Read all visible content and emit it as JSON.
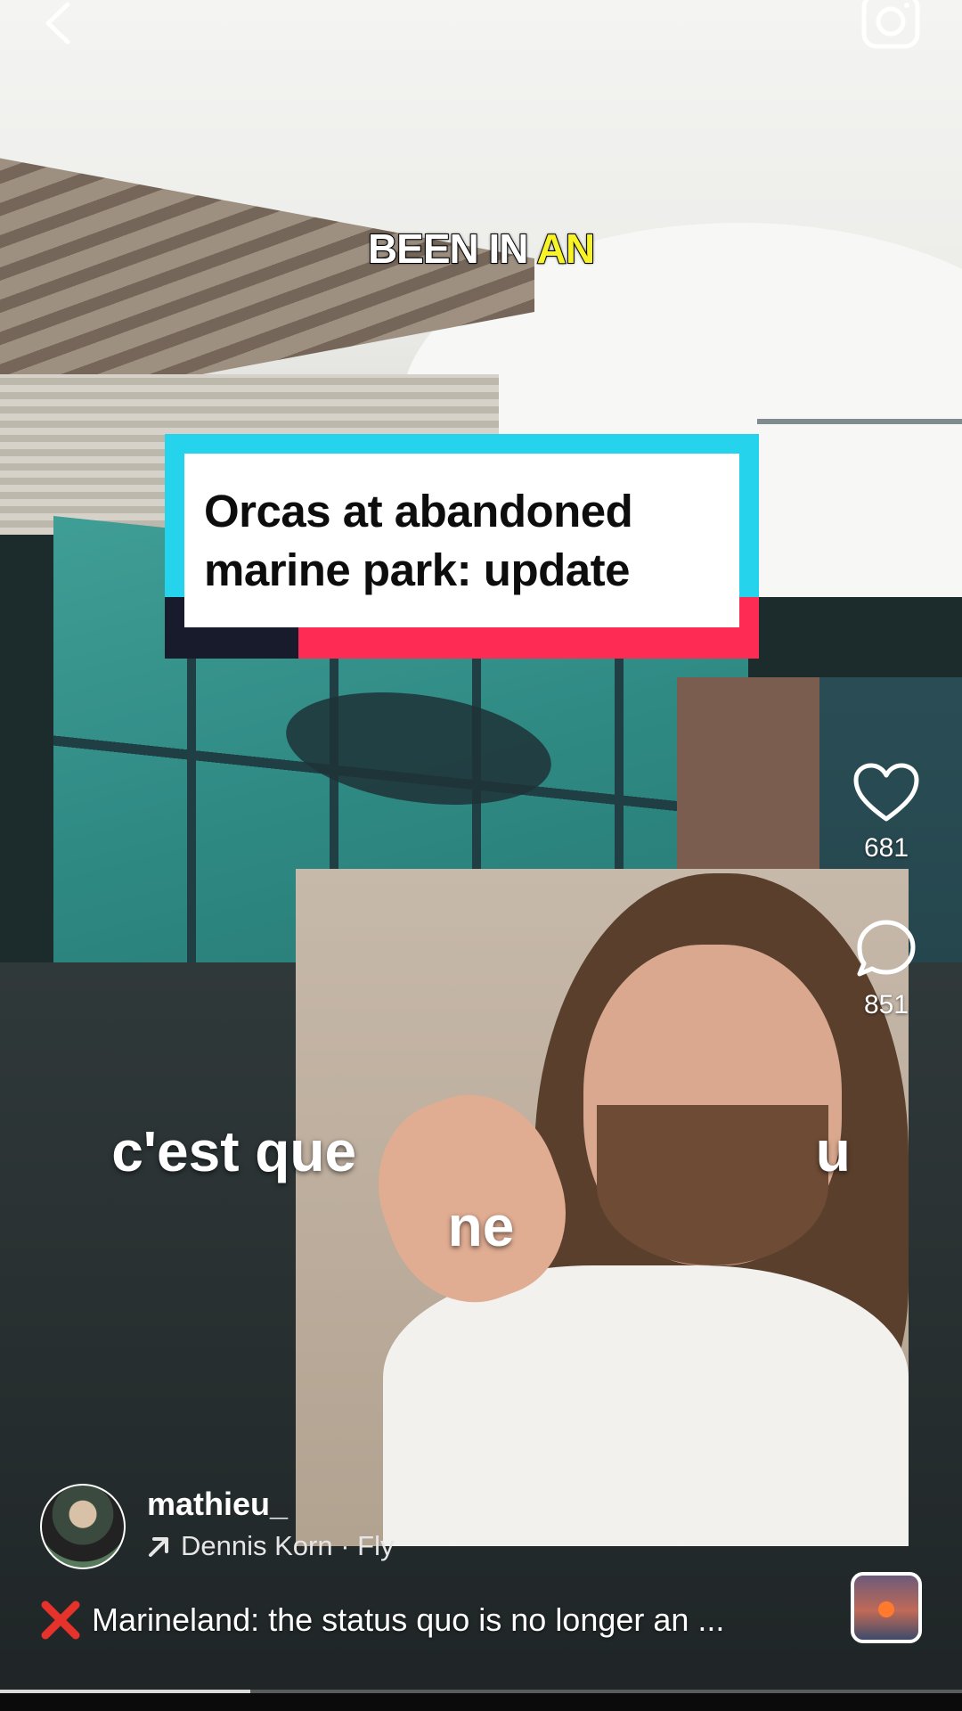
{
  "caption_top": {
    "part1": "BEEN IN ",
    "part2": "AN"
  },
  "title_card": {
    "line1": "Orcas at abandoned",
    "line2": "marine park: update"
  },
  "subtitle": {
    "line1": "c'est que                             u",
    "line2": "ne"
  },
  "actions": {
    "likes": "681",
    "comments": "851"
  },
  "user": {
    "username": "mathieu_",
    "audio": "Dennis Korn · Fly"
  },
  "caption": {
    "text": "Marineland: the status quo is no longer an ..."
  },
  "progress": {
    "fraction": 0.26
  },
  "colors": {
    "cyan": "#25d3ec",
    "red": "#fe2c55",
    "dark": "#171b2b",
    "highlight": "#f8f325"
  },
  "icons": [
    "back-arrow-icon",
    "camera-icon",
    "heart-icon",
    "comment-icon",
    "arrow-up-right-icon",
    "red-x-icon"
  ]
}
